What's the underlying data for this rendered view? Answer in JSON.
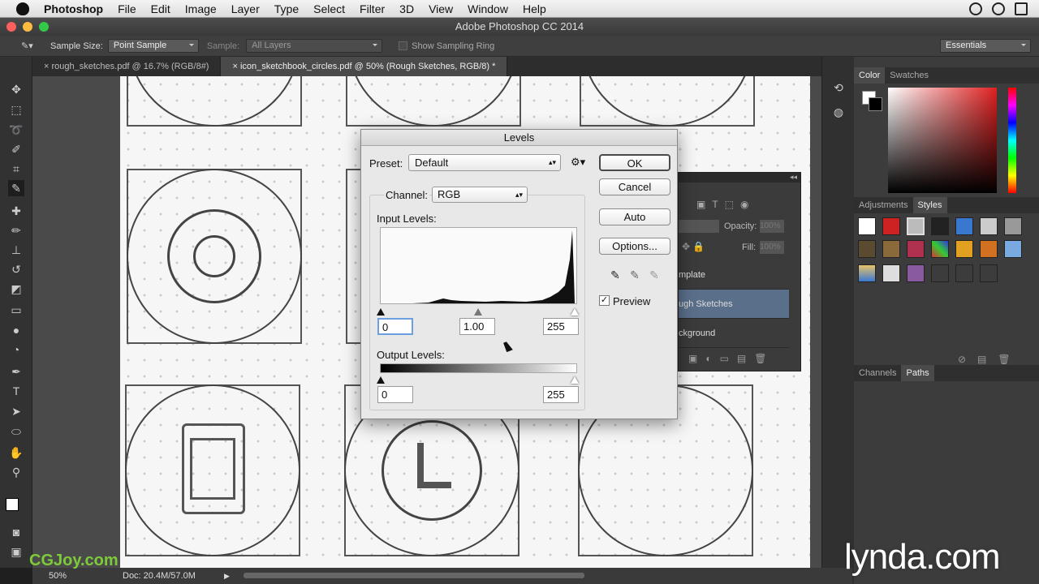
{
  "menubar": {
    "app": "Photoshop",
    "items": [
      "File",
      "Edit",
      "Image",
      "Layer",
      "Type",
      "Select",
      "Filter",
      "3D",
      "View",
      "Window",
      "Help"
    ]
  },
  "window": {
    "title": "Adobe Photoshop CC 2014"
  },
  "options": {
    "sample_size_label": "Sample Size:",
    "sample_size_value": "Point Sample",
    "sample_label": "Sample:",
    "sample_value": "All Layers",
    "show_ring": "Show Sampling Ring",
    "workspace": "Essentials"
  },
  "tabs": [
    "rough_sketches.pdf @ 16.7% (RGB/8#)",
    "icon_sketchbook_circles.pdf @ 50% (Rough Sketches, RGB/8) *"
  ],
  "levels": {
    "title": "Levels",
    "preset_label": "Preset:",
    "preset_value": "Default",
    "channel_label": "Channel:",
    "channel_value": "RGB",
    "input_levels_label": "Input Levels:",
    "input_black": "0",
    "input_mid": "1.00",
    "input_white": "255",
    "output_levels_label": "Output Levels:",
    "output_black": "0",
    "output_white": "255",
    "buttons": {
      "ok": "OK",
      "cancel": "Cancel",
      "auto": "Auto",
      "options": "Options..."
    },
    "preview_label": "Preview",
    "preview_checked": true
  },
  "panels": {
    "color_tab": "Color",
    "swatches_tab": "Swatches",
    "adjustments_tab": "Adjustments",
    "styles_tab": "Styles",
    "channels_tab": "Channels",
    "paths_tab": "Paths"
  },
  "layers": {
    "opacity_label": "Opacity:",
    "opacity_value": "100%",
    "fill_label": "Fill:",
    "fill_value": "100%",
    "rows": [
      "mplate",
      "ugh Sketches",
      "ckground"
    ]
  },
  "status": {
    "zoom": "50%",
    "doc": "Doc: 20.4M/57.0M"
  },
  "watermark": {
    "lynda": "lynda.com",
    "cgjoy": "CGJoy.com"
  },
  "colors": {
    "accent": "#3d7bd6",
    "panel": "#3c3c3c",
    "canvas": "#f6f6f6"
  }
}
